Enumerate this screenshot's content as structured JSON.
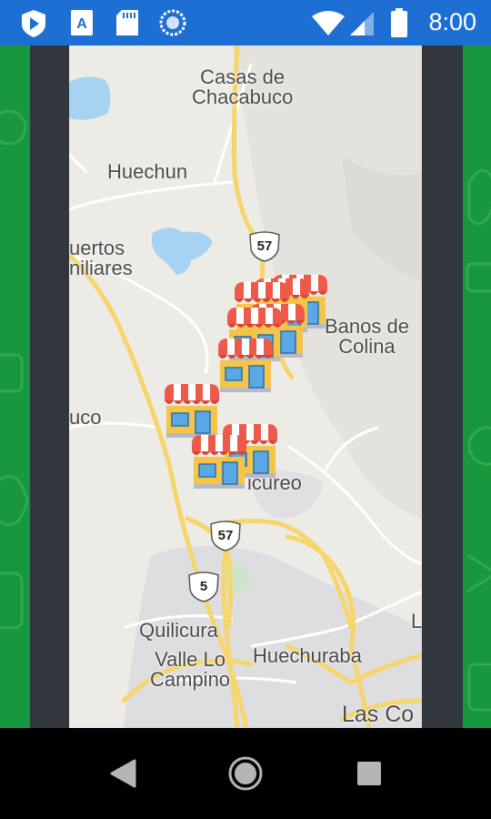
{
  "status_bar": {
    "time": "8:00",
    "icons": [
      "shield-app-icon",
      "font-app-icon",
      "sd-card-icon",
      "sync-icon",
      "wifi-icon",
      "signal-icon",
      "battery-icon"
    ]
  },
  "map": {
    "places": {
      "casas": "Casas de\nChacabuco",
      "huechun": "Huechun",
      "puertos": "uertos\nniliares",
      "banos": "Banos de\nColina",
      "bucalemu": "uco",
      "chicureo": "icureo",
      "quilicura": "Quilicura",
      "valle": "Valle Lo\nCampino",
      "huechuraba": "Huechuraba",
      "lascondes": "Las Co",
      "edge_l": "L"
    },
    "route_shields": {
      "r57_top": "57",
      "r57_bottom": "57",
      "r5": "5"
    },
    "store_markers_count": 9
  },
  "colors": {
    "status_bar": "#1e6fd4",
    "app_background": "#17983f",
    "frame": "#32363d",
    "map_land": "#ecebe6",
    "highway": "#f7d56d",
    "water": "#a8d2f2"
  }
}
